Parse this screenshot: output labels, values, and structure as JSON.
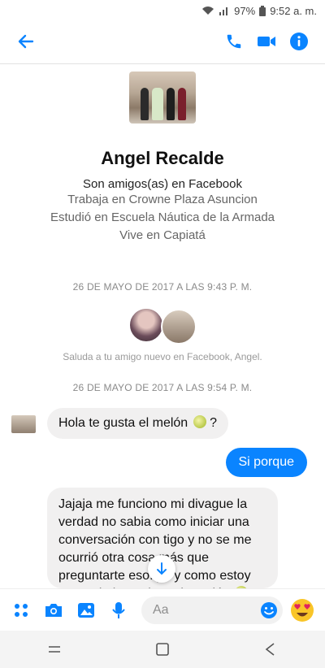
{
  "status": {
    "battery": "97%",
    "time": "9:52 a. m."
  },
  "colors": {
    "accent": "#0a84ff",
    "bubble_in": "#f1f0f0"
  },
  "header": {
    "icons": [
      "back-arrow-icon",
      "phone-icon",
      "video-camera-icon",
      "info-icon"
    ]
  },
  "profile": {
    "name": "Angel Recalde",
    "friends_line": "Son amigos(as) en Facebook",
    "work": "Trabaja en Crowne Plaza Asuncion",
    "studied": "Estudió en Escuela Náutica de la Armada",
    "lives": "Vive en Capiatá"
  },
  "conversation": {
    "timestamp1": "26 DE MAYO DE 2017 A LAS 9:43 P. M.",
    "hint": "Saluda a tu amigo nuevo en Facebook, Angel.",
    "timestamp2": "26 DE MAYO DE 2017 A LAS 9:54 P. M.",
    "msg1": "Hola te gusta el melón",
    "msg1_suffix": "?",
    "msg2": "Si porque",
    "msg3": "Jajaja me funciono mi divague la verdad no sabia como iniciar una conversación con tigo y no se me ocurrió otra cosa más que preguntarte eso. ya y como estoy tomando luego jugo de melón"
  },
  "composer": {
    "placeholder": "Aa",
    "icons": [
      "apps-grid-icon",
      "camera-icon",
      "gallery-icon",
      "microphone-icon",
      "emoji-smile-icon",
      "heart-eyes-emoji-icon"
    ]
  },
  "navigation": {
    "icons": [
      "recents-icon",
      "home-icon",
      "back-icon"
    ]
  }
}
